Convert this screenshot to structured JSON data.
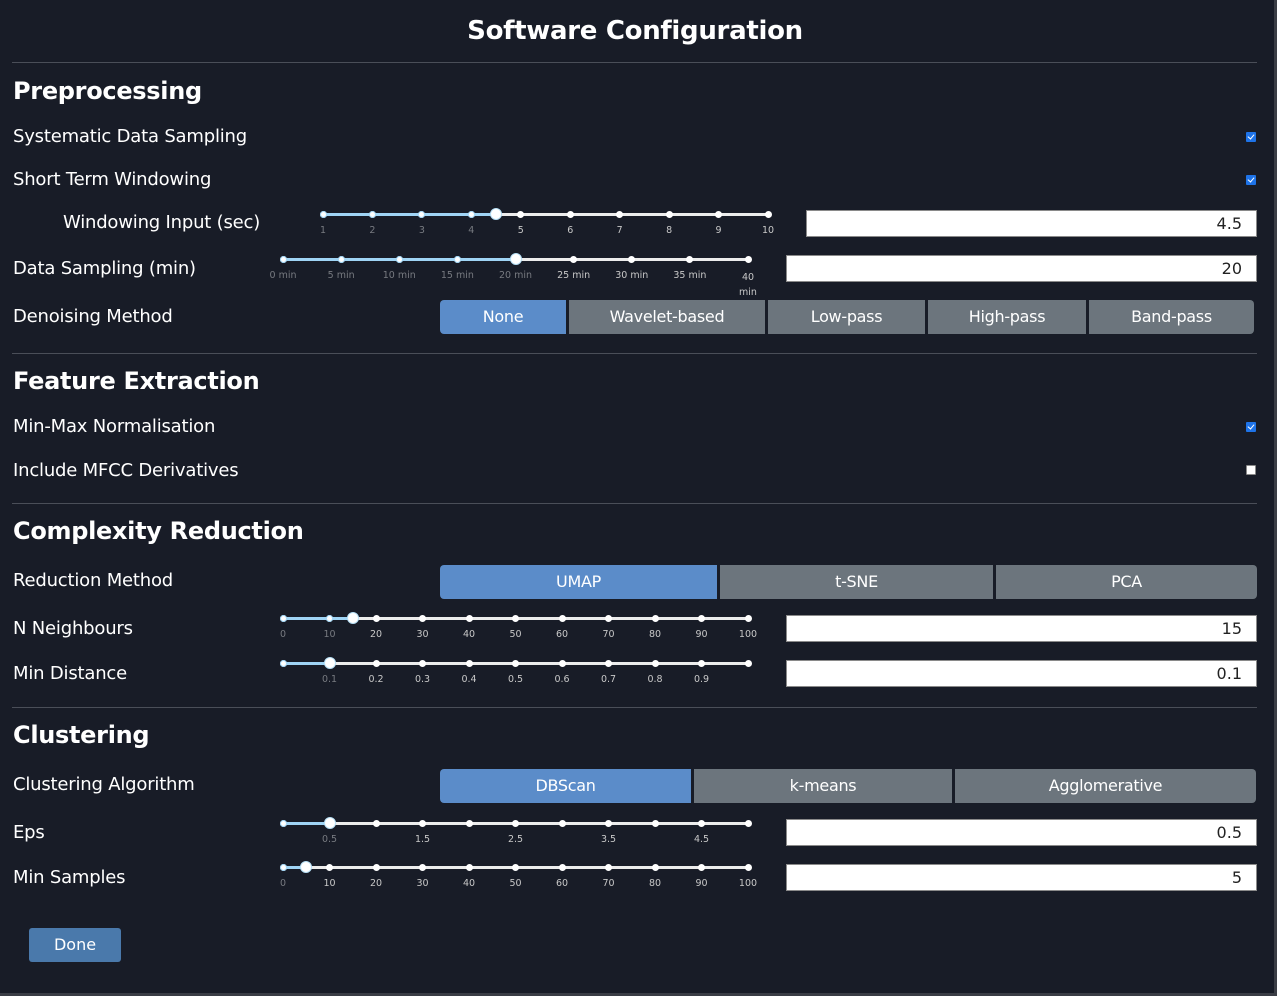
{
  "title": "Software Configuration",
  "sections": {
    "preprocessing": {
      "title": "Preprocessing",
      "systematic_sampling": {
        "label": "Systematic Data Sampling",
        "checked": true
      },
      "short_term_windowing": {
        "label": "Short Term Windowing",
        "checked": true
      },
      "windowing_input": {
        "label": "Windowing Input (sec)",
        "value": "4.5",
        "slider_value": 4.5,
        "min": 1,
        "max": 10,
        "ticks": [
          "1",
          "2",
          "3",
          "4",
          "5",
          "6",
          "7",
          "8",
          "9",
          "10"
        ]
      },
      "data_sampling": {
        "label": "Data Sampling (min)",
        "value": "20",
        "slider_value": 20,
        "min": 0,
        "max": 40,
        "ticks": [
          "0 min",
          "5 min",
          "10 min",
          "15 min",
          "20 min",
          "25 min",
          "30 min",
          "35 min",
          "40 min"
        ]
      },
      "denoising": {
        "label": "Denoising Method",
        "options": [
          "None",
          "Wavelet-based",
          "Low-pass",
          "High-pass",
          "Band-pass"
        ],
        "selected": "None"
      }
    },
    "feature_extraction": {
      "title": "Feature Extraction",
      "minmax": {
        "label": "Min-Max Normalisation",
        "checked": true
      },
      "mfcc": {
        "label": "Include MFCC Derivatives",
        "checked": false
      }
    },
    "complexity_reduction": {
      "title": "Complexity Reduction",
      "method": {
        "label": "Reduction Method",
        "options": [
          "UMAP",
          "t-SNE",
          "PCA"
        ],
        "selected": "UMAP"
      },
      "n_neighbours": {
        "label": "N Neighbours",
        "value": "15",
        "slider_value": 15,
        "min": 0,
        "max": 100,
        "ticks": [
          "0",
          "10",
          "20",
          "30",
          "40",
          "50",
          "60",
          "70",
          "80",
          "90",
          "100"
        ]
      },
      "min_distance": {
        "label": "Min Distance",
        "value": "0.1",
        "slider_value": 0.1,
        "min": 0,
        "max": 1,
        "ticks": [
          "",
          "0.1",
          "0.2",
          "0.3",
          "0.4",
          "0.5",
          "0.6",
          "0.7",
          "0.8",
          "0.9",
          ""
        ]
      }
    },
    "clustering": {
      "title": "Clustering",
      "algorithm": {
        "label": "Clustering Algorithm",
        "options": [
          "DBScan",
          "k-means",
          "Agglomerative"
        ],
        "selected": "DBScan"
      },
      "eps": {
        "label": "Eps",
        "value": "0.5",
        "slider_value": 0.5,
        "min": 0,
        "max": 5,
        "ticks": [
          "",
          "0.5",
          "",
          "1.5",
          "",
          "2.5",
          "",
          "3.5",
          "",
          "4.5",
          ""
        ]
      },
      "min_samples": {
        "label": "Min Samples",
        "value": "5",
        "slider_value": 5,
        "min": 0,
        "max": 100,
        "ticks": [
          "0",
          "10",
          "20",
          "30",
          "40",
          "50",
          "60",
          "70",
          "80",
          "90",
          "100"
        ]
      }
    }
  },
  "done_label": "Done"
}
